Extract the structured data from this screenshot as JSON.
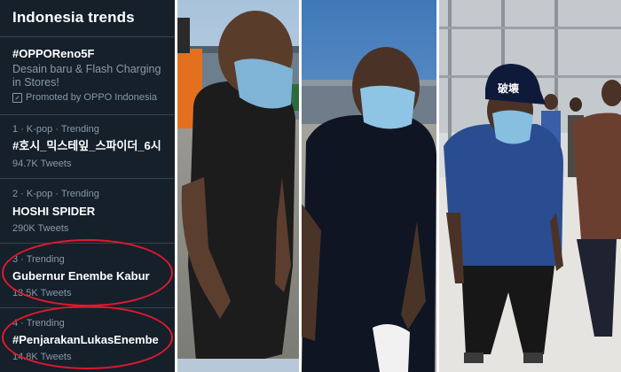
{
  "trends_panel": {
    "title": "Indonesia trends",
    "promoted": {
      "name": "#OPPOReno5F",
      "description_line1": "Desain baru & Flash Charging",
      "description_line2": "in Stores!",
      "promoted_by": "Promoted by OPPO Indonesia",
      "icon": "promoted-icon"
    },
    "trends": [
      {
        "meta": "1 · K-pop · Trending",
        "name": "#호시_믹스테잎_스파이더_6시",
        "count": "94.7K Tweets"
      },
      {
        "meta": "2 · K-pop · Trending",
        "name": "HOSHI SPIDER",
        "count": "290K Tweets"
      },
      {
        "meta": "3 · Trending",
        "name": "Gubernur Enembe Kabur",
        "count": "13.5K Tweets"
      },
      {
        "meta": "4 · Trending",
        "name": "#PenjarakanLukasEnembe",
        "count": "14.8K Tweets"
      }
    ],
    "highlight_color": "#e0182d"
  },
  "photos": {
    "cap_text": "破壊"
  }
}
